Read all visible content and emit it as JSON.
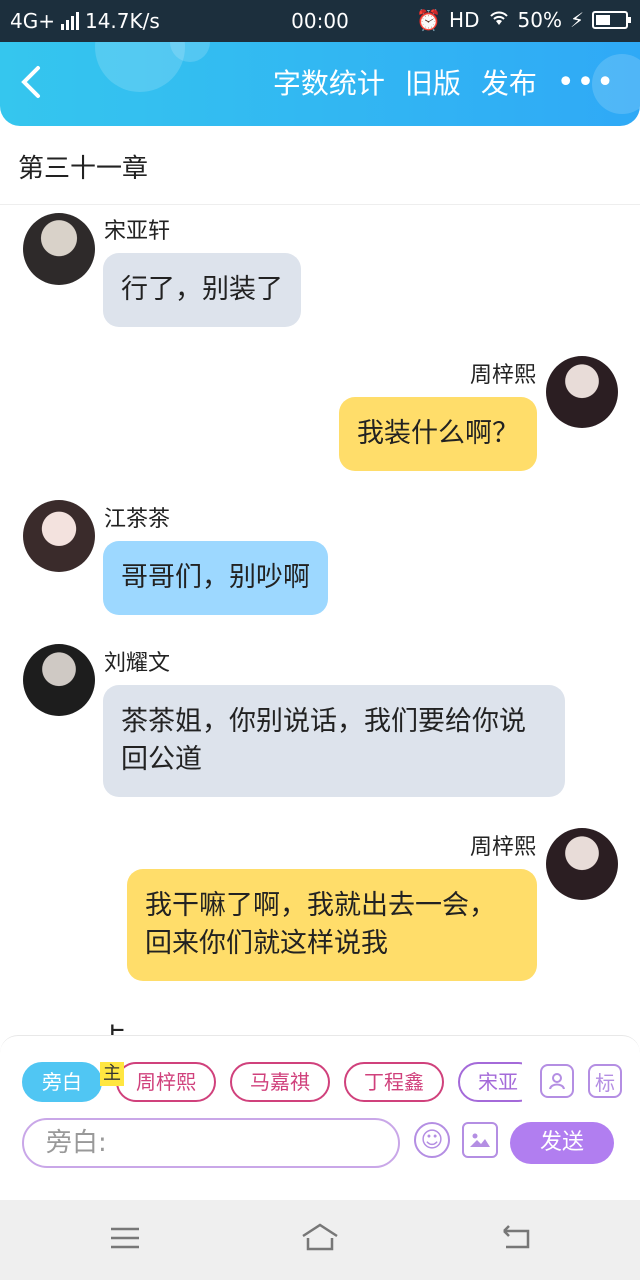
{
  "status": {
    "network": "4G+",
    "speed": "14.7K/s",
    "time": "00:00",
    "hd": "HD",
    "battery": "50%",
    "battery_level": 0.5
  },
  "header": {
    "back_icon": "back-chevron-icon",
    "actions": [
      "字数统计",
      "旧版",
      "发布"
    ],
    "more_icon": "more-dots-icon"
  },
  "chapter_title": "第三十一章",
  "messages": [
    {
      "speaker": "宋亚轩",
      "text": "行了，别装了",
      "side": "left",
      "color": "gray"
    },
    {
      "speaker": "周梓熙",
      "text": "我装什么啊？",
      "side": "right",
      "color": "yellow"
    },
    {
      "speaker": "江茶茶",
      "text": "哥哥们，别吵啊",
      "side": "left",
      "color": "blue"
    },
    {
      "speaker": "刘耀文",
      "text": "茶茶姐，你别说话，我们要给你说回公道",
      "side": "left",
      "color": "gray"
    },
    {
      "speaker": "周梓熙",
      "text": "我干嘛了啊，我就出去一会，回来你们就这样说我",
      "side": "right",
      "color": "yellow"
    }
  ],
  "partial_text": "卡",
  "composer": {
    "chips": [
      "旁白",
      "周梓熙",
      "马嘉祺",
      "丁程鑫",
      "宋亚"
    ],
    "main_tag": "主",
    "avatar_btn_icon": "character-icon",
    "mark_btn": "标",
    "placeholder": "旁白:",
    "emoji_icon": "emoji-icon",
    "image_icon": "image-icon",
    "send_label": "发送"
  },
  "nav": {
    "menu_icon": "menu-icon",
    "home_icon": "home-icon",
    "back_icon": "back-icon"
  },
  "colors": {
    "header_start": "#35c6ee",
    "header_end": "#2fa9f6",
    "bubble_gray": "#dde3ec",
    "bubble_yellow": "#ffdd6a",
    "bubble_blue": "#9dd8ff",
    "send": "#b17ef0"
  }
}
